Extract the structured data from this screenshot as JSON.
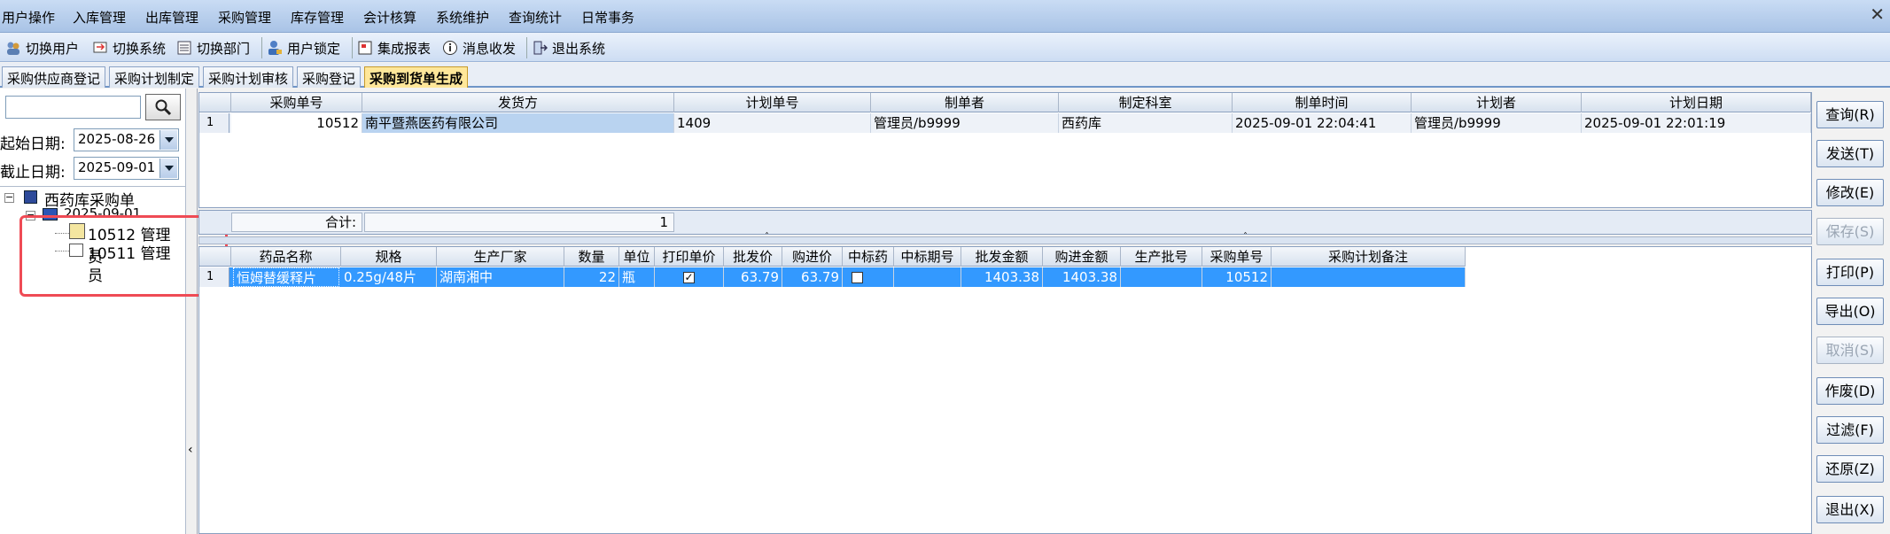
{
  "menu": [
    "用户操作",
    "入库管理",
    "出库管理",
    "采购管理",
    "库存管理",
    "会计核算",
    "系统维护",
    "查询统计",
    "日常事务"
  ],
  "toolbar": {
    "switch_user": "切换用户",
    "switch_system": "切换系统",
    "switch_dept": "切换部门",
    "user_lock": "用户锁定",
    "report": "集成报表",
    "message": "消息收发",
    "exit": "退出系统"
  },
  "tabs": [
    "采购供应商登记",
    "采购计划制定",
    "采购计划审核",
    "采购登记",
    "采购到货单生成"
  ],
  "filter": {
    "search_value": "",
    "start_label": "起始日期:",
    "start_date": "2025-08-26",
    "end_label": "截止日期:",
    "end_date": "2025-09-01"
  },
  "tree": {
    "root": "西药库采购单",
    "date_node": "2025-09-01",
    "items": [
      {
        "id": "10512",
        "user": "管理员"
      },
      {
        "id": "10511",
        "user": "管理员"
      }
    ]
  },
  "upper_grid": {
    "headers": [
      "采购单号",
      "发货方",
      "计划单号",
      "制单者",
      "制定科室",
      "制单时间",
      "计划者",
      "计划日期"
    ],
    "rows": [
      {
        "num": "1",
        "order_no": "10512",
        "supplier": "南平暨燕医药有限公司",
        "plan_no": "1409",
        "maker": "管理员/b9999",
        "dept": "西药库",
        "make_time": "2025-09-01 22:04:41",
        "planner": "管理员/b9999",
        "plan_date": "2025-09-01 22:01:19"
      }
    ]
  },
  "summary": {
    "label": "合计:",
    "value": "1"
  },
  "lower_grid": {
    "headers": [
      "药品名称",
      "规格",
      "生产厂家",
      "数量",
      "单位",
      "打印单价",
      "批发价",
      "购进价",
      "中标药",
      "中标期号",
      "批发金额",
      "购进金额",
      "生产批号",
      "采购单号",
      "采购计划备注"
    ],
    "rows": [
      {
        "num": "1",
        "name": "恒姆替缓释片",
        "spec": "0.25g/48片",
        "maker": "湖南湘中",
        "qty": "22",
        "unit": "瓶",
        "print_price": true,
        "wholesale": "63.79",
        "purchase": "63.79",
        "bid": false,
        "bid_period": "",
        "wholesale_amt": "1403.38",
        "purchase_amt": "1403.38",
        "batch": "",
        "order_no": "10512",
        "remark": ""
      }
    ]
  },
  "buttons": [
    {
      "label": "查询(R)",
      "enabled": true
    },
    {
      "label": "发送(T)",
      "enabled": true
    },
    {
      "label": "修改(E)",
      "enabled": true
    },
    {
      "label": "保存(S)",
      "enabled": false
    },
    {
      "label": "打印(P)",
      "enabled": true
    },
    {
      "label": "导出(O)",
      "enabled": true
    },
    {
      "label": "取消(S)",
      "enabled": false
    },
    {
      "label": "作废(D)",
      "enabled": true
    },
    {
      "label": "过滤(F)",
      "enabled": true
    },
    {
      "label": "还原(Z)",
      "enabled": true
    },
    {
      "label": "退出(X)",
      "enabled": true
    }
  ],
  "colors": {
    "selected_row": "#3399ff",
    "highlight_cell": "#b9d3f0",
    "active_tab": "#ffe79a",
    "annotation": "#ef4b55"
  }
}
